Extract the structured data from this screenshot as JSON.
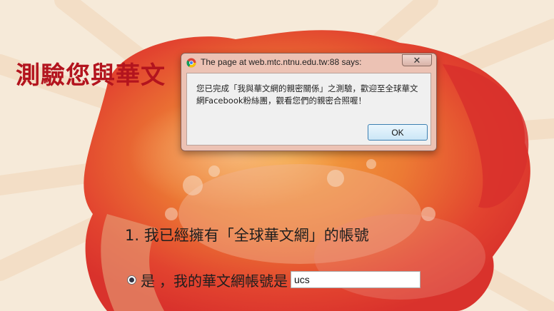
{
  "page": {
    "title": "測驗您與華文",
    "question": "1. 我已經擁有「全球華文網」的帳號",
    "answer_yes": "是",
    "answer_label": "，我的華文網帳號是",
    "account_value": "ucs"
  },
  "dialog": {
    "title": "The page at web.mtc.ntnu.edu.tw:88 says:",
    "close_label": "✕",
    "message": "您已完成「我與華文網的親密關係」之測驗，歡迎至全球華文網Facebook粉絲團，觀看您們的親密合照喔！",
    "ok_label": "OK"
  },
  "colors": {
    "title_red": "#b3141e",
    "splash_orange": "#f0902e",
    "splash_red": "#e0402d",
    "background": "#f6ead9"
  }
}
